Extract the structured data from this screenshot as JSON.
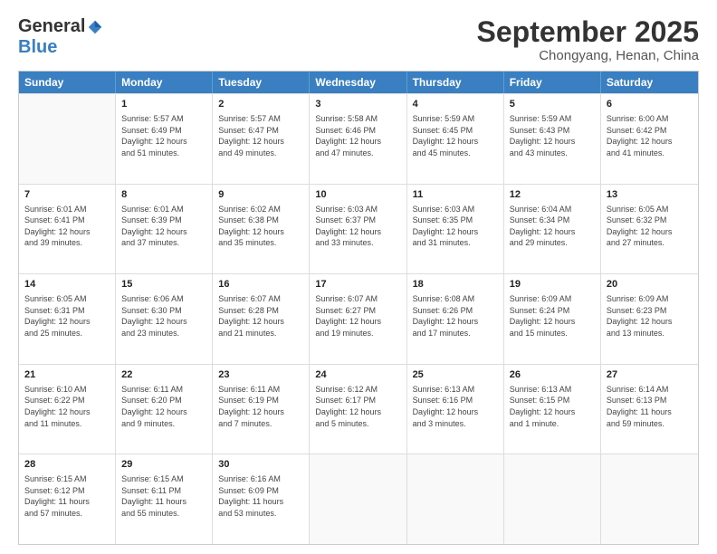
{
  "logo": {
    "general": "General",
    "blue": "Blue"
  },
  "title": "September 2025",
  "location": "Chongyang, Henan, China",
  "header_days": [
    "Sunday",
    "Monday",
    "Tuesday",
    "Wednesday",
    "Thursday",
    "Friday",
    "Saturday"
  ],
  "weeks": [
    [
      {
        "day": "",
        "lines": [],
        "empty": true
      },
      {
        "day": "1",
        "lines": [
          "Sunrise: 5:57 AM",
          "Sunset: 6:49 PM",
          "Daylight: 12 hours",
          "and 51 minutes."
        ]
      },
      {
        "day": "2",
        "lines": [
          "Sunrise: 5:57 AM",
          "Sunset: 6:47 PM",
          "Daylight: 12 hours",
          "and 49 minutes."
        ]
      },
      {
        "day": "3",
        "lines": [
          "Sunrise: 5:58 AM",
          "Sunset: 6:46 PM",
          "Daylight: 12 hours",
          "and 47 minutes."
        ]
      },
      {
        "day": "4",
        "lines": [
          "Sunrise: 5:59 AM",
          "Sunset: 6:45 PM",
          "Daylight: 12 hours",
          "and 45 minutes."
        ]
      },
      {
        "day": "5",
        "lines": [
          "Sunrise: 5:59 AM",
          "Sunset: 6:43 PM",
          "Daylight: 12 hours",
          "and 43 minutes."
        ]
      },
      {
        "day": "6",
        "lines": [
          "Sunrise: 6:00 AM",
          "Sunset: 6:42 PM",
          "Daylight: 12 hours",
          "and 41 minutes."
        ]
      }
    ],
    [
      {
        "day": "7",
        "lines": [
          "Sunrise: 6:01 AM",
          "Sunset: 6:41 PM",
          "Daylight: 12 hours",
          "and 39 minutes."
        ]
      },
      {
        "day": "8",
        "lines": [
          "Sunrise: 6:01 AM",
          "Sunset: 6:39 PM",
          "Daylight: 12 hours",
          "and 37 minutes."
        ]
      },
      {
        "day": "9",
        "lines": [
          "Sunrise: 6:02 AM",
          "Sunset: 6:38 PM",
          "Daylight: 12 hours",
          "and 35 minutes."
        ]
      },
      {
        "day": "10",
        "lines": [
          "Sunrise: 6:03 AM",
          "Sunset: 6:37 PM",
          "Daylight: 12 hours",
          "and 33 minutes."
        ]
      },
      {
        "day": "11",
        "lines": [
          "Sunrise: 6:03 AM",
          "Sunset: 6:35 PM",
          "Daylight: 12 hours",
          "and 31 minutes."
        ]
      },
      {
        "day": "12",
        "lines": [
          "Sunrise: 6:04 AM",
          "Sunset: 6:34 PM",
          "Daylight: 12 hours",
          "and 29 minutes."
        ]
      },
      {
        "day": "13",
        "lines": [
          "Sunrise: 6:05 AM",
          "Sunset: 6:32 PM",
          "Daylight: 12 hours",
          "and 27 minutes."
        ]
      }
    ],
    [
      {
        "day": "14",
        "lines": [
          "Sunrise: 6:05 AM",
          "Sunset: 6:31 PM",
          "Daylight: 12 hours",
          "and 25 minutes."
        ]
      },
      {
        "day": "15",
        "lines": [
          "Sunrise: 6:06 AM",
          "Sunset: 6:30 PM",
          "Daylight: 12 hours",
          "and 23 minutes."
        ]
      },
      {
        "day": "16",
        "lines": [
          "Sunrise: 6:07 AM",
          "Sunset: 6:28 PM",
          "Daylight: 12 hours",
          "and 21 minutes."
        ]
      },
      {
        "day": "17",
        "lines": [
          "Sunrise: 6:07 AM",
          "Sunset: 6:27 PM",
          "Daylight: 12 hours",
          "and 19 minutes."
        ]
      },
      {
        "day": "18",
        "lines": [
          "Sunrise: 6:08 AM",
          "Sunset: 6:26 PM",
          "Daylight: 12 hours",
          "and 17 minutes."
        ]
      },
      {
        "day": "19",
        "lines": [
          "Sunrise: 6:09 AM",
          "Sunset: 6:24 PM",
          "Daylight: 12 hours",
          "and 15 minutes."
        ]
      },
      {
        "day": "20",
        "lines": [
          "Sunrise: 6:09 AM",
          "Sunset: 6:23 PM",
          "Daylight: 12 hours",
          "and 13 minutes."
        ]
      }
    ],
    [
      {
        "day": "21",
        "lines": [
          "Sunrise: 6:10 AM",
          "Sunset: 6:22 PM",
          "Daylight: 12 hours",
          "and 11 minutes."
        ]
      },
      {
        "day": "22",
        "lines": [
          "Sunrise: 6:11 AM",
          "Sunset: 6:20 PM",
          "Daylight: 12 hours",
          "and 9 minutes."
        ]
      },
      {
        "day": "23",
        "lines": [
          "Sunrise: 6:11 AM",
          "Sunset: 6:19 PM",
          "Daylight: 12 hours",
          "and 7 minutes."
        ]
      },
      {
        "day": "24",
        "lines": [
          "Sunrise: 6:12 AM",
          "Sunset: 6:17 PM",
          "Daylight: 12 hours",
          "and 5 minutes."
        ]
      },
      {
        "day": "25",
        "lines": [
          "Sunrise: 6:13 AM",
          "Sunset: 6:16 PM",
          "Daylight: 12 hours",
          "and 3 minutes."
        ]
      },
      {
        "day": "26",
        "lines": [
          "Sunrise: 6:13 AM",
          "Sunset: 6:15 PM",
          "Daylight: 12 hours",
          "and 1 minute."
        ]
      },
      {
        "day": "27",
        "lines": [
          "Sunrise: 6:14 AM",
          "Sunset: 6:13 PM",
          "Daylight: 11 hours",
          "and 59 minutes."
        ]
      }
    ],
    [
      {
        "day": "28",
        "lines": [
          "Sunrise: 6:15 AM",
          "Sunset: 6:12 PM",
          "Daylight: 11 hours",
          "and 57 minutes."
        ]
      },
      {
        "day": "29",
        "lines": [
          "Sunrise: 6:15 AM",
          "Sunset: 6:11 PM",
          "Daylight: 11 hours",
          "and 55 minutes."
        ]
      },
      {
        "day": "30",
        "lines": [
          "Sunrise: 6:16 AM",
          "Sunset: 6:09 PM",
          "Daylight: 11 hours",
          "and 53 minutes."
        ]
      },
      {
        "day": "",
        "lines": [],
        "empty": true
      },
      {
        "day": "",
        "lines": [],
        "empty": true
      },
      {
        "day": "",
        "lines": [],
        "empty": true
      },
      {
        "day": "",
        "lines": [],
        "empty": true
      }
    ]
  ]
}
